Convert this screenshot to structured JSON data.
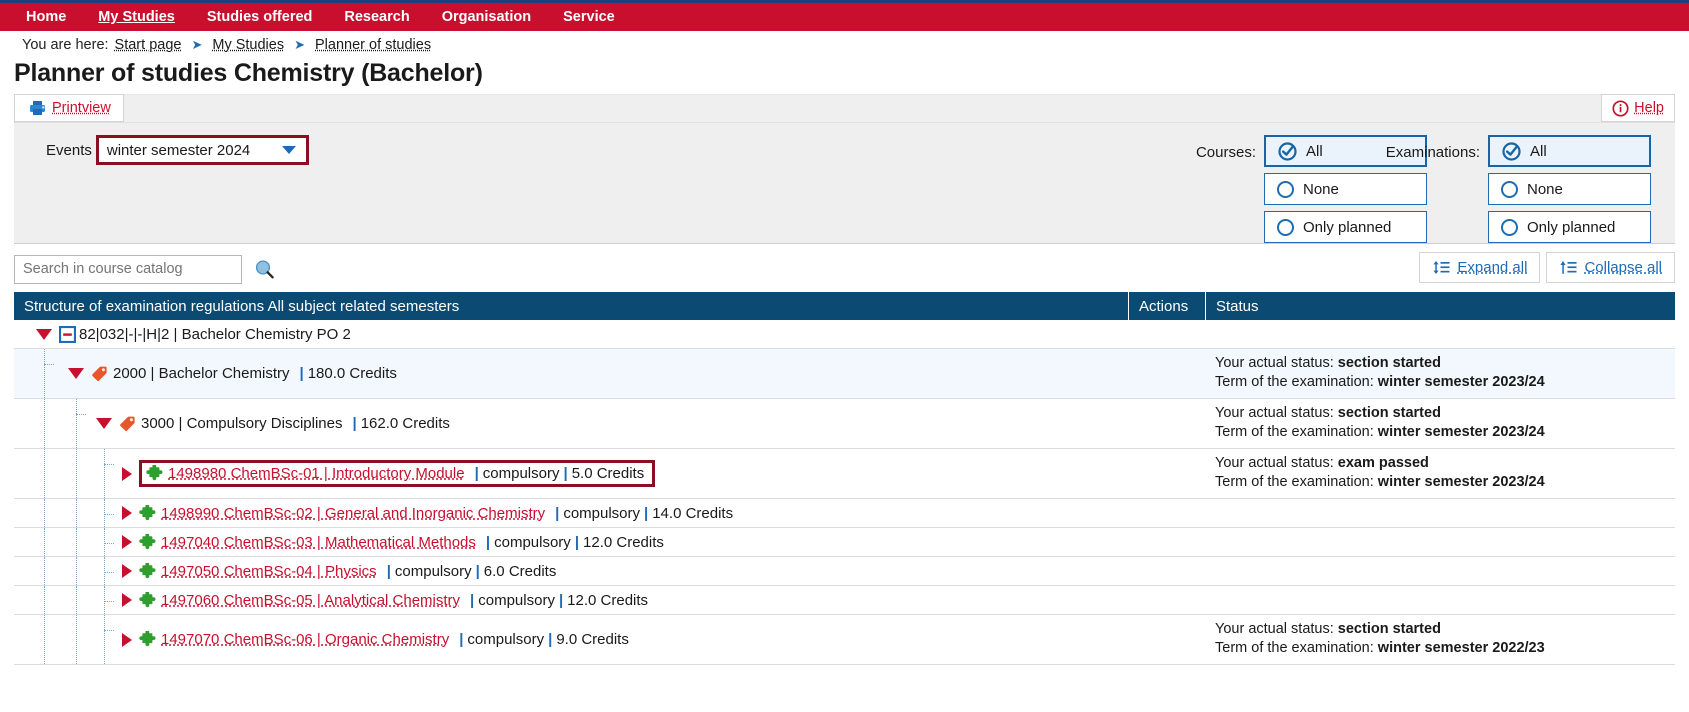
{
  "nav": {
    "items": [
      {
        "label": "Home",
        "active": false
      },
      {
        "label": "My Studies",
        "active": true
      },
      {
        "label": "Studies offered",
        "active": false
      },
      {
        "label": "Research",
        "active": false
      },
      {
        "label": "Organisation",
        "active": false
      },
      {
        "label": "Service",
        "active": false
      }
    ]
  },
  "breadcrumb": {
    "prefix": "You are here:",
    "items": [
      "Start page",
      "My Studies",
      "Planner of studies"
    ]
  },
  "page": {
    "title": "Planner of studies Chemistry (Bachelor)"
  },
  "toolbar": {
    "printview_label": "Printview",
    "printview_icon": "printer-icon",
    "help_label": "Help",
    "help_icon": "info-icon"
  },
  "filters": {
    "events_label": "Events",
    "semester_value": "winter semester 2024",
    "semester_options": [
      "winter semester 2024"
    ],
    "courses_label": "Courses:",
    "examinations_label": "Examinations:",
    "courses_options": [
      {
        "label": "All",
        "selected": true
      },
      {
        "label": "None",
        "selected": false
      },
      {
        "label": "Only planned",
        "selected": false
      }
    ],
    "examinations_options": [
      {
        "label": "All",
        "selected": true
      },
      {
        "label": "None",
        "selected": false
      },
      {
        "label": "Only planned",
        "selected": false
      }
    ]
  },
  "search": {
    "placeholder": "Search in course catalog",
    "value": "",
    "icon": "magnifier-icon"
  },
  "tree_actions": {
    "expand_label": "Expand all",
    "collapse_label": "Collapse all"
  },
  "table": {
    "headers": {
      "structure": "Structure of examination regulations All subject related semesters",
      "actions": "Actions",
      "status": "Status"
    },
    "status_labels": {
      "actual": "Your actual status:",
      "term": "Term of the examination:"
    },
    "rows": [
      {
        "level": 0,
        "icon": "minus-box-icon",
        "twisty": "down",
        "text": "82|032|-|-|H|2 | Bachelor Chemistry PO 2",
        "link": false,
        "highlight": false,
        "shade": false,
        "status_actual": "",
        "status_term": ""
      },
      {
        "level": 1,
        "icon": "tag-icon",
        "twisty": "down",
        "code": "2000",
        "name": "Bachelor Chemistry",
        "credits": "180.0 Credits",
        "type": "",
        "link": false,
        "highlight": false,
        "shade": true,
        "status_actual": "section started",
        "status_term": "winter semester 2023/24"
      },
      {
        "level": 2,
        "icon": "tag-icon",
        "twisty": "down",
        "code": "3000",
        "name": "Compulsory Disciplines",
        "credits": "162.0 Credits",
        "type": "",
        "link": false,
        "highlight": false,
        "shade": false,
        "status_actual": "section started",
        "status_term": "winter semester 2023/24"
      },
      {
        "level": 3,
        "icon": "puzzle-icon",
        "twisty": "right",
        "code": "1498980 ChemBSc-01",
        "name": "Introductory Module",
        "credits": "5.0 Credits",
        "type": "compulsory",
        "link": true,
        "highlight": true,
        "shade": false,
        "status_actual": "exam passed",
        "status_term": "winter semester 2023/24"
      },
      {
        "level": 3,
        "icon": "puzzle-icon",
        "twisty": "right",
        "code": "1498990 ChemBSc-02",
        "name": "General and Inorganic Chemistry",
        "credits": "14.0 Credits",
        "type": "compulsory",
        "link": true,
        "highlight": false,
        "shade": false,
        "status_actual": "",
        "status_term": ""
      },
      {
        "level": 3,
        "icon": "puzzle-icon",
        "twisty": "right",
        "code": "1497040 ChemBSc-03",
        "name": "Mathematical Methods",
        "credits": "12.0 Credits",
        "type": "compulsory",
        "link": true,
        "highlight": false,
        "shade": false,
        "status_actual": "",
        "status_term": ""
      },
      {
        "level": 3,
        "icon": "puzzle-icon",
        "twisty": "right",
        "code": "1497050 ChemBSc-04",
        "name": "Physics",
        "credits": "6.0 Credits",
        "type": "compulsory",
        "link": true,
        "highlight": false,
        "shade": false,
        "status_actual": "",
        "status_term": ""
      },
      {
        "level": 3,
        "icon": "puzzle-icon",
        "twisty": "right",
        "code": "1497060 ChemBSc-05",
        "name": "Analytical Chemistry",
        "credits": "12.0 Credits",
        "type": "compulsory",
        "link": true,
        "highlight": false,
        "shade": false,
        "status_actual": "",
        "status_term": ""
      },
      {
        "level": 3,
        "icon": "puzzle-icon",
        "twisty": "right",
        "code": "1497070 ChemBSc-06",
        "name": "Organic Chemistry",
        "credits": "9.0 Credits",
        "type": "compulsory",
        "link": true,
        "highlight": false,
        "shade": false,
        "status_actual": "section started",
        "status_term": "winter semester 2022/23"
      }
    ]
  },
  "colors": {
    "brand_red": "#c8102e",
    "dark_red": "#8a0f22",
    "header_blue": "#0b4a72",
    "link_blue": "#1f6bb5",
    "green": "#2e9e2e",
    "panel_gray": "#efefef"
  }
}
